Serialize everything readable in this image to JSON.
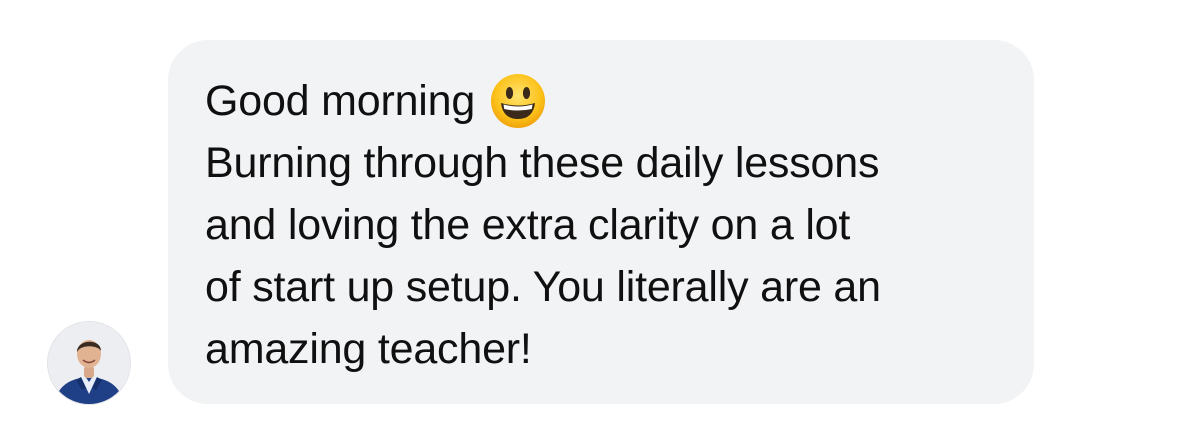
{
  "message": {
    "greeting": "Good morning",
    "greeting_emoji": "grinning-face-emoji",
    "lines": [
      "Burning through these daily lessons",
      "and loving the extra clarity on a lot",
      "of start up setup. You literally are an",
      "amazing teacher!"
    ]
  },
  "sender": {
    "avatar": "profile-photo-man-blue-suit"
  },
  "colors": {
    "bubble_background": "#f2f3f5",
    "text": "#101010",
    "page_background": "#ffffff"
  }
}
